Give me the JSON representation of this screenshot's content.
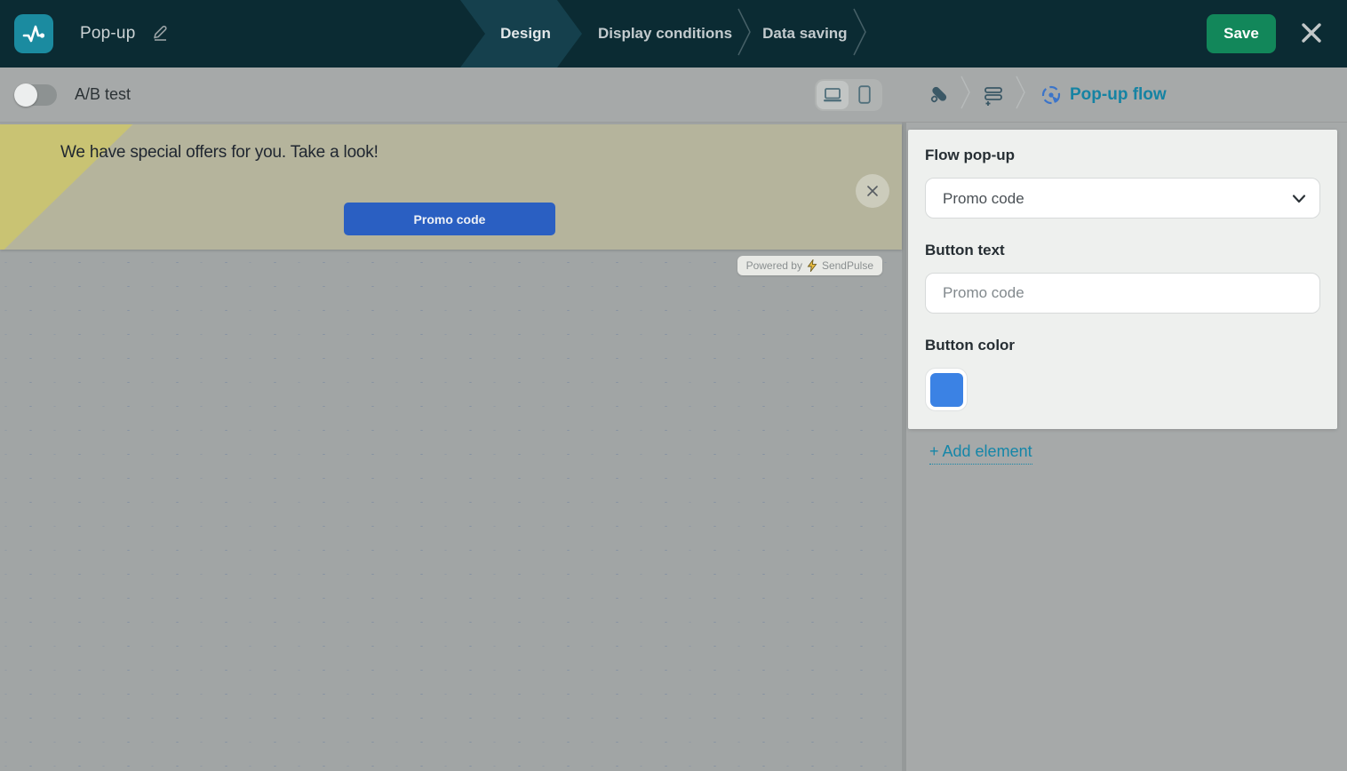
{
  "topbar": {
    "title": "Pop-up",
    "tabs": [
      {
        "label": "Design"
      },
      {
        "label": "Display conditions"
      },
      {
        "label": "Data saving"
      }
    ],
    "save_label": "Save"
  },
  "toolbar": {
    "ab_test_label": "A/B test"
  },
  "breadcrumb": {
    "current": "Pop-up flow"
  },
  "popup_preview": {
    "message": "We have special offers for you. Take a look!",
    "button_label": "Promo code",
    "close_label": "✕",
    "powered_by": "Powered by",
    "brand": "SendPulse"
  },
  "panel": {
    "flow_label": "Flow pop-up",
    "flow_value": "Promo code",
    "button_text_label": "Button text",
    "button_text_value": "Promo code",
    "button_color_label": "Button color",
    "button_color": "#3b82e4",
    "add_element_label": "+ Add element"
  },
  "colors": {
    "topbar_bg": "#0b2b33",
    "active_tab_bg": "#15404d",
    "save_green": "#12875a",
    "banner_bg": "#b5b49c",
    "banner_wedge": "#c9c373",
    "promo_blue": "#2a5fc2",
    "accent_teal": "#1586a8",
    "logo_teal": "#1b8ba0"
  }
}
